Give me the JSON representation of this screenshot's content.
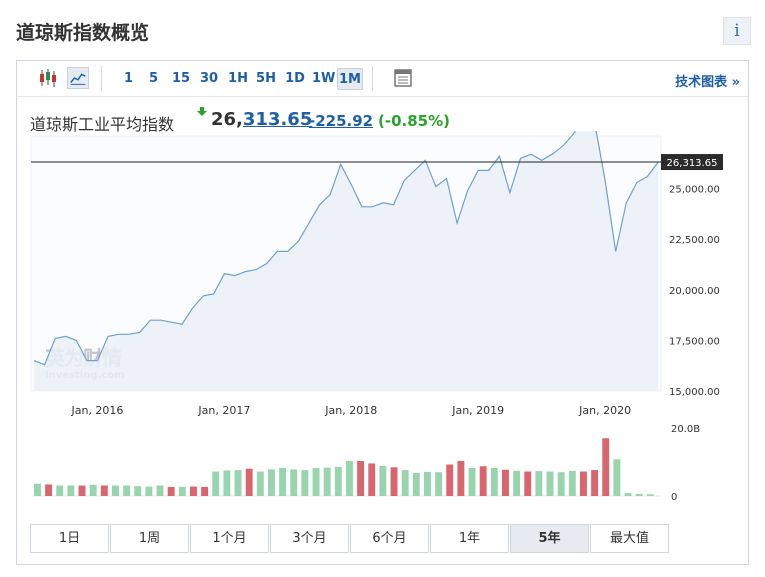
{
  "header": {
    "title": "道琼斯指数概览",
    "info_label": "i"
  },
  "toolbar": {
    "intervals": [
      "1",
      "5",
      "15",
      "30",
      "1H",
      "5H",
      "1D",
      "1W",
      "1M"
    ],
    "active_interval": "1M",
    "tech_chart_label": "技术图表 »"
  },
  "quote": {
    "name": "道琼斯工业平均指数",
    "price_lead": "26,",
    "price_tail": "313.65",
    "change": "-225.92",
    "change_pct": "(-0.85%)"
  },
  "colors": {
    "line": "#6fa0d0",
    "area": "#e9f0f7",
    "vol_up": "#98d4ad",
    "vol_down": "#d9666f",
    "accent": "#1f5fa8",
    "positive": "#28a428"
  },
  "ranges": {
    "items": [
      "1日",
      "1周",
      "1个月",
      "3个月",
      "6个月",
      "1年",
      "5年",
      "最大值"
    ],
    "active": "5年"
  },
  "chart_data": {
    "type": "area",
    "x_tick_labels": [
      "Jan, 2016",
      "Jan, 2017",
      "Jan, 2018",
      "Jan, 2019",
      "Jan, 2020"
    ],
    "y_ticks": [
      "25,000.00",
      "22,500.00",
      "20,000.00",
      "17,500.00",
      "15,000.00"
    ],
    "y_tick_values": [
      25000,
      22500,
      20000,
      17500,
      15000
    ],
    "ylim": [
      15000,
      27600
    ],
    "current_value_label": "26,313.65",
    "current_value": 26313.65,
    "watermark": "英为财情 Investing.com",
    "x": [
      "2015-07",
      "2015-08",
      "2015-09",
      "2015-10",
      "2015-11",
      "2015-12",
      "2016-01",
      "2016-02",
      "2016-03",
      "2016-04",
      "2016-05",
      "2016-06",
      "2016-07",
      "2016-08",
      "2016-09",
      "2016-10",
      "2016-11",
      "2016-12",
      "2017-01",
      "2017-02",
      "2017-03",
      "2017-04",
      "2017-05",
      "2017-06",
      "2017-07",
      "2017-08",
      "2017-09",
      "2017-10",
      "2017-11",
      "2017-12",
      "2018-01",
      "2018-02",
      "2018-03",
      "2018-04",
      "2018-05",
      "2018-06",
      "2018-07",
      "2018-08",
      "2018-09",
      "2018-10",
      "2018-11",
      "2018-12",
      "2019-01",
      "2019-02",
      "2019-03",
      "2019-04",
      "2019-05",
      "2019-06",
      "2019-07",
      "2019-08",
      "2019-09",
      "2019-10",
      "2019-11",
      "2019-12",
      "2020-01",
      "2020-02",
      "2020-03",
      "2020-04",
      "2020-05",
      "2020-06"
    ],
    "values": [
      16500,
      16300,
      17600,
      17700,
      17500,
      16500,
      16500,
      17700,
      17800,
      17800,
      17900,
      18500,
      18500,
      18400,
      18300,
      19100,
      19700,
      19800,
      20800,
      20700,
      20900,
      21000,
      21300,
      21900,
      21900,
      22400,
      23300,
      24200,
      24700,
      26200,
      25200,
      24100,
      24100,
      24300,
      24200,
      25400,
      25900,
      26400,
      25100,
      25500,
      23300,
      24900,
      25900,
      25900,
      26600,
      24800,
      26500,
      26700,
      26400,
      26700,
      27100,
      27700,
      28500,
      28300,
      25400,
      21900,
      24300,
      25300,
      25600,
      26300
    ],
    "volume_axis_labels": [
      "20.0B",
      "0"
    ],
    "volume_max": 20,
    "volume": [
      {
        "v": 3.5,
        "d": 1
      },
      {
        "v": 3.3,
        "d": 0
      },
      {
        "v": 3.0,
        "d": 1
      },
      {
        "v": 3.0,
        "d": 1
      },
      {
        "v": 3.0,
        "d": 0
      },
      {
        "v": 3.2,
        "d": 1
      },
      {
        "v": 3.0,
        "d": 0
      },
      {
        "v": 3.0,
        "d": 1
      },
      {
        "v": 3.0,
        "d": 1
      },
      {
        "v": 2.8,
        "d": 1
      },
      {
        "v": 2.7,
        "d": 1
      },
      {
        "v": 3.0,
        "d": 1
      },
      {
        "v": 2.6,
        "d": 0
      },
      {
        "v": 2.6,
        "d": 1
      },
      {
        "v": 2.7,
        "d": 0
      },
      {
        "v": 2.6,
        "d": 0
      },
      {
        "v": 7.0,
        "d": 1
      },
      {
        "v": 7.3,
        "d": 1
      },
      {
        "v": 7.4,
        "d": 1
      },
      {
        "v": 7.8,
        "d": 0
      },
      {
        "v": 7.0,
        "d": 1
      },
      {
        "v": 7.6,
        "d": 1
      },
      {
        "v": 8.0,
        "d": 1
      },
      {
        "v": 7.6,
        "d": 1
      },
      {
        "v": 7.4,
        "d": 1
      },
      {
        "v": 8.0,
        "d": 1
      },
      {
        "v": 8.1,
        "d": 1
      },
      {
        "v": 8.3,
        "d": 1
      },
      {
        "v": 10.0,
        "d": 1
      },
      {
        "v": 10.0,
        "d": 0
      },
      {
        "v": 9.3,
        "d": 0
      },
      {
        "v": 8.6,
        "d": 1
      },
      {
        "v": 8.2,
        "d": 0
      },
      {
        "v": 7.4,
        "d": 1
      },
      {
        "v": 6.6,
        "d": 1
      },
      {
        "v": 6.9,
        "d": 1
      },
      {
        "v": 6.8,
        "d": 1
      },
      {
        "v": 9.0,
        "d": 0
      },
      {
        "v": 10.0,
        "d": 0
      },
      {
        "v": 8.0,
        "d": 1
      },
      {
        "v": 8.5,
        "d": 0
      },
      {
        "v": 8.0,
        "d": 1
      },
      {
        "v": 7.5,
        "d": 0
      },
      {
        "v": 7.2,
        "d": 1
      },
      {
        "v": 7.0,
        "d": 0
      },
      {
        "v": 7.1,
        "d": 1
      },
      {
        "v": 7.0,
        "d": 1
      },
      {
        "v": 6.8,
        "d": 1
      },
      {
        "v": 7.2,
        "d": 1
      },
      {
        "v": 7.0,
        "d": 0
      },
      {
        "v": 7.4,
        "d": 0
      },
      {
        "v": 16.5,
        "d": 0
      },
      {
        "v": 10.5,
        "d": 1
      },
      {
        "v": 0.8,
        "d": 1
      },
      {
        "v": 0.6,
        "d": 1
      },
      {
        "v": 0.5,
        "d": 1
      }
    ]
  }
}
